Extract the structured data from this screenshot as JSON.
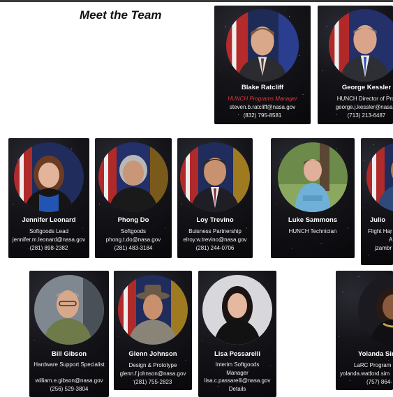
{
  "page": {
    "title": "Meet the Team"
  },
  "team": {
    "blake": {
      "name": "Blake Ratcliff",
      "role": "HUNCH Programs Manager",
      "email": "steven.b.ratcliff@nasa.gov",
      "phone": "(832) 795-8581"
    },
    "george": {
      "name": "George Kessler",
      "role": "HUNCH Director of Proj",
      "email": "george.j.kessler@nasa.g",
      "phone": "(713) 213-6487"
    },
    "jennifer": {
      "name": "Jennifer Leonard",
      "role": "Softgoods Lead",
      "email": "jennifer.m.leonard@nasa.gov",
      "phone": "(281) 898-2382"
    },
    "phong": {
      "name": "Phong Do",
      "role": "Softgoods",
      "email": "phong.t.do@nasa.gov",
      "phone": "(281) 483-3184"
    },
    "loy": {
      "name": "Loy Trevino",
      "role": "Buisness Partnership",
      "email": "elroy.w.trevino@nasa.gov",
      "phone": "(281) 244-0706"
    },
    "luke": {
      "name": "Luke Sammons",
      "role": "HUNCH Technician"
    },
    "julio": {
      "name": "Julio",
      "role": "Flight Har",
      "line2": "A",
      "email": "jzambr"
    },
    "bill": {
      "name": "Bill Gibson",
      "role": "Hardware Support Specialist",
      "email": "william.e.gibson@nasa.gov",
      "phone": "(256) 529-3804"
    },
    "glenn": {
      "name": "Glenn Johnson",
      "role": "Design & Prototype",
      "email": "glenn.f.johnson@nasa.gov",
      "phone": "(281) 755-2823"
    },
    "lisa": {
      "name": "Lisa Pessarelli",
      "role": "Interim Softgoods Manager",
      "email": "lisa.c.passarelli@nasa.gov",
      "details": "Details"
    },
    "yolanda": {
      "name": "Yolanda Sir",
      "role": "LaRC Program",
      "email": "yolanda.watford.sim",
      "phone": "(757) 864-"
    }
  },
  "colors": {
    "background": "#ffffff",
    "card": "#0c0c10",
    "role_highlight": "#e03a3a"
  }
}
